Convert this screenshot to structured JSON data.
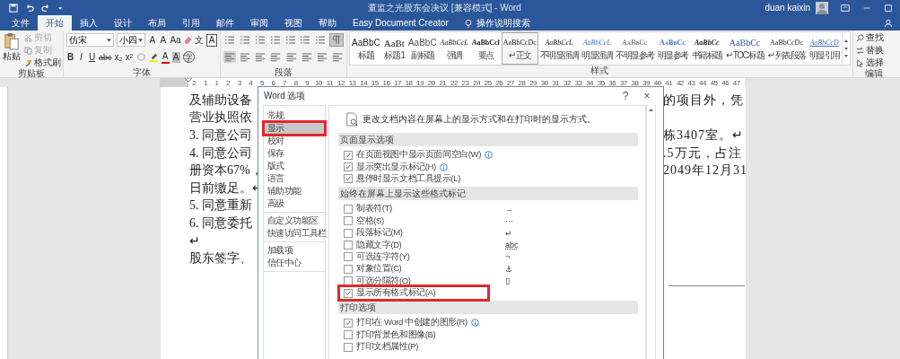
{
  "title_bar": {
    "title": "董监之光股东会决议 [兼容模式] - Word",
    "user": "duan kaixin"
  },
  "tabs": [
    {
      "label": "文件",
      "selected": false
    },
    {
      "label": "开始",
      "selected": true
    },
    {
      "label": "插入",
      "selected": false
    },
    {
      "label": "设计",
      "selected": false
    },
    {
      "label": "布局",
      "selected": false
    },
    {
      "label": "引用",
      "selected": false
    },
    {
      "label": "邮件",
      "selected": false
    },
    {
      "label": "审阅",
      "selected": false
    },
    {
      "label": "视图",
      "selected": false
    },
    {
      "label": "帮助",
      "selected": false
    },
    {
      "label": "Easy Document Creator",
      "selected": false
    }
  ],
  "tell_me": "操作说明搜索",
  "clipboard": {
    "paste": "粘贴",
    "cut": "剪切",
    "copy": "复制",
    "format_painter": "格式刷",
    "group": "剪贴板"
  },
  "font": {
    "name": "仿宋",
    "size": "小四",
    "row1": [
      "A",
      "A",
      "Aa"
    ],
    "phonetic": "文",
    "boxed": "A",
    "row2": [
      "B",
      "I",
      "U",
      "abc",
      "x₂",
      "x²"
    ],
    "color_letter": "A",
    "shaded": "A",
    "enclosed": "字",
    "group": "字体"
  },
  "paragraph": {
    "show_marks_pressed": true,
    "group": "段落"
  },
  "styles": {
    "group": "样式",
    "items": [
      {
        "preview": "AaBbC",
        "label": "标题",
        "kind": "title",
        "selected": false
      },
      {
        "preview": "AaBt",
        "label": "标题 1",
        "kind": "h1",
        "selected": false
      },
      {
        "preview": "AaBbC",
        "label": "副标题",
        "kind": "subtitle",
        "selected": false
      },
      {
        "preview": "AaBbCcL",
        "label": "强调",
        "kind": "italic",
        "selected": false
      },
      {
        "preview": "AaBbCcl",
        "label": "要点",
        "kind": "bold",
        "selected": false
      },
      {
        "preview": "AaBbCcDc",
        "label": "↵ 正文",
        "kind": "normal",
        "selected": true
      },
      {
        "preview": "AaBbCcL",
        "label": "不明显强调",
        "kind": "italic",
        "selected": false
      },
      {
        "preview": "AaBbCcL",
        "label": "明显强调",
        "kind": "blueitalic",
        "selected": false
      },
      {
        "preview": "AaBbCc",
        "label": "不明显参考",
        "kind": "caps",
        "selected": false
      },
      {
        "preview": "AaBbCc",
        "label": "明显参考",
        "kind": "bluecaps",
        "selected": false
      },
      {
        "preview": "AaBbCc",
        "label": "书籍标题",
        "kind": "bolditalic",
        "selected": false
      },
      {
        "preview": "AaBbCc",
        "label": "↵ TOC 标题",
        "kind": "blue",
        "selected": false
      },
      {
        "preview": "AaBbCcDc",
        "label": "↵ 列表段落",
        "kind": "normal",
        "selected": false
      },
      {
        "preview": "AaBbCcD",
        "label": "明显引用",
        "kind": "quote",
        "selected": false
      }
    ]
  },
  "editing": {
    "find": "查找",
    "replace": "替换",
    "select": "选择",
    "group": "编辑"
  },
  "ruler": {
    "before": [
      "2",
      "1"
    ],
    "numbers": [
      "1",
      "2",
      "3",
      "4",
      "5",
      "6",
      "7",
      "8",
      "9",
      "10",
      "11",
      "12",
      "13",
      "14",
      "15",
      "16",
      "17",
      "18",
      "19",
      "20",
      "21",
      "22",
      "23",
      "24",
      "25",
      "26",
      "27",
      "28",
      "29",
      "30",
      "31",
      "32",
      "33",
      "34",
      "35",
      "36",
      "37",
      "38",
      "39",
      "40",
      "41",
      "42",
      "43",
      "44",
      "45",
      "46",
      "47"
    ]
  },
  "document": {
    "lines": [
      {
        "left": "及辅助设备",
        "right": "的项目外，凭"
      },
      {
        "left": "营业执照依"
      },
      {
        "left": "3. 同意公司",
        "right": "栋3407室。↵"
      },
      {
        "left": "4. 同意公司",
        "right": ".5万元，占注"
      },
      {
        "left": "册资本67%，",
        "right": "2049年12月31"
      },
      {
        "left": "日前缴足。↵"
      },
      {
        "left": "5. 同意重新"
      },
      {
        "left": "6. 同意委托"
      },
      {
        "left": "↵"
      },
      {
        "left": "股东签字、"
      }
    ]
  },
  "dialog": {
    "title": "Word 选项",
    "help": "?",
    "close": "×",
    "nav": [
      [
        {
          "label": "常规",
          "selected": false,
          "highlighted": false
        },
        {
          "label": "显示",
          "selected": true,
          "highlighted": true
        },
        {
          "label": "校对",
          "selected": false,
          "highlighted": false
        },
        {
          "label": "保存",
          "selected": false,
          "highlighted": false
        },
        {
          "label": "版式",
          "selected": false,
          "highlighted": false
        },
        {
          "label": "语言",
          "selected": false,
          "highlighted": false
        },
        {
          "label": "辅助功能",
          "selected": false,
          "highlighted": false
        },
        {
          "label": "高级",
          "selected": false,
          "highlighted": false
        }
      ],
      [
        {
          "label": "自定义功能区",
          "selected": false,
          "highlighted": false
        },
        {
          "label": "快速访问工具栏",
          "selected": false,
          "highlighted": false
        }
      ],
      [
        {
          "label": "加载项",
          "selected": false,
          "highlighted": false
        },
        {
          "label": "信任中心",
          "selected": false,
          "highlighted": false
        }
      ]
    ],
    "intro": "更改文档内容在屏幕上的显示方式和在打印时的显示方式。",
    "sections": [
      {
        "title": "页面显示选项",
        "options": [
          {
            "label": "在页面视图中显示页面间空白(W)",
            "checked": true,
            "info": true,
            "highlighted": false
          },
          {
            "label": "显示突出显示标记(H)",
            "checked": true,
            "info": true,
            "highlighted": false
          },
          {
            "label": "悬停时显示文档工具提示(L)",
            "checked": true,
            "info": false,
            "highlighted": false
          }
        ]
      },
      {
        "title": "始终在屏幕上显示这些格式标记",
        "options": [
          {
            "label": "制表符(T)",
            "checked": false,
            "info": false,
            "symbol": "→",
            "highlighted": false
          },
          {
            "label": "空格(S)",
            "checked": false,
            "info": false,
            "symbol": "···",
            "highlighted": false
          },
          {
            "label": "段落标记(M)",
            "checked": false,
            "info": false,
            "symbol": "↵",
            "highlighted": false
          },
          {
            "label": "隐藏文字(D)",
            "checked": false,
            "info": false,
            "symbol": "abc",
            "highlighted": false
          },
          {
            "label": "可选连字符(Y)",
            "checked": false,
            "info": false,
            "symbol": "¬",
            "highlighted": false
          },
          {
            "label": "对象位置(C)",
            "checked": false,
            "info": false,
            "symbol": "⚓",
            "highlighted": false
          },
          {
            "label": "可选分隔符(O)",
            "checked": false,
            "info": false,
            "symbol": "▯",
            "highlighted": false
          },
          {
            "label": "显示所有格式标记(A)",
            "checked": true,
            "info": false,
            "highlighted": true
          }
        ]
      },
      {
        "title": "打印选项",
        "options": [
          {
            "label": "打印在 Word 中创建的图形(R)",
            "checked": true,
            "info": true,
            "highlighted": false
          },
          {
            "label": "打印背景色和图像(B)",
            "checked": false,
            "info": false,
            "highlighted": false
          },
          {
            "label": "打印文档属性(P)",
            "checked": false,
            "info": false,
            "highlighted": false
          }
        ]
      }
    ]
  }
}
